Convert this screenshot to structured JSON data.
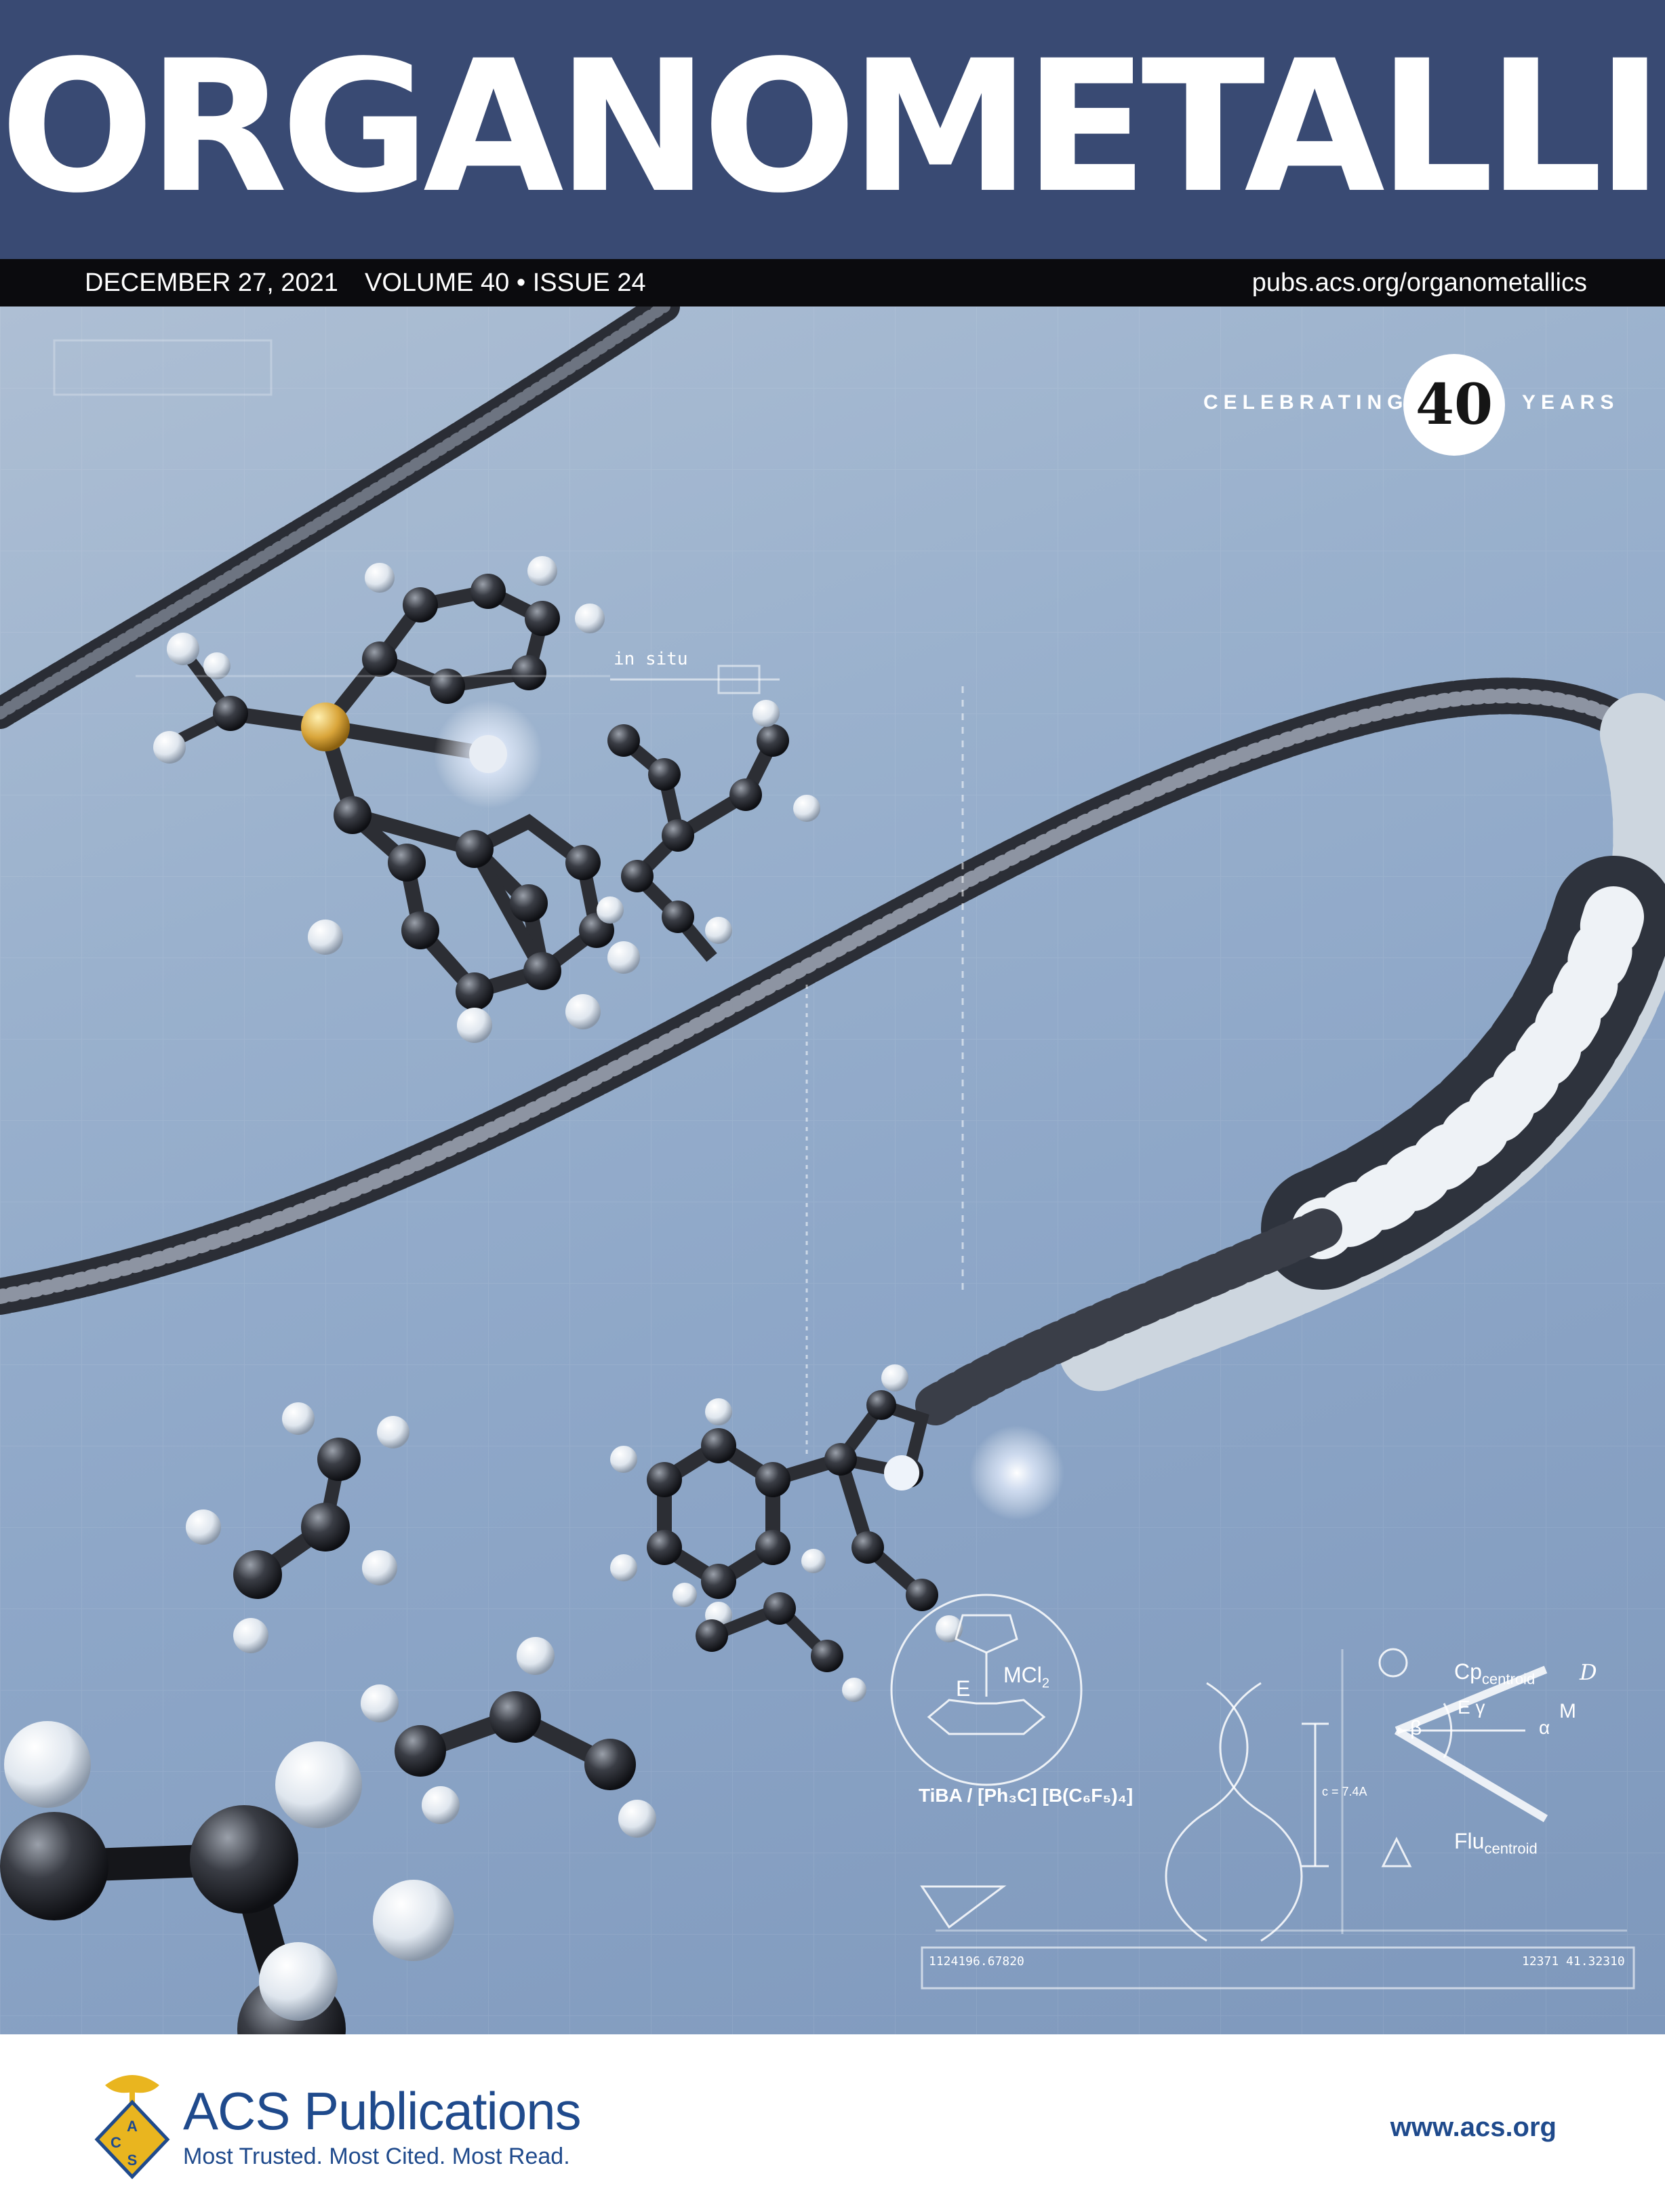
{
  "journal": {
    "title": "ORGANOMETALLICS"
  },
  "issue": {
    "date": "DECEMBER 27, 2021",
    "volume_issue": "VOLUME 40 • ISSUE 24",
    "url": "pubs.acs.org/organometallics"
  },
  "anniversary": {
    "prefix": "CELEBRATING",
    "number": "40",
    "suffix": "YEARS"
  },
  "annotations": {
    "in_situ": "in situ",
    "catalyst_metal_label": "E",
    "catalyst_metal_formula": "MCl",
    "catalyst_metal_subscript": "2",
    "activator": "TiBA / [Ph₃C] [B(C₆F₅)₄]",
    "pitch": "c = 7.4A",
    "cp_centroid": "Cp",
    "cp_centroid_sub": "centroid",
    "flu_centroid": "Flu",
    "flu_centroid_sub": "centroid",
    "angle_beta": "β",
    "angle_gamma": "E γ",
    "angle_alpha": "α",
    "metal_M": "M",
    "distance_D": "D",
    "readout_left": "1124196.67820",
    "readout_right": "12371 41.32310"
  },
  "publisher": {
    "name": "ACS Publications",
    "tagline": "Most Trusted. Most Cited. Most Read.",
    "url": "www.acs.org",
    "logo_letters": [
      "A",
      "C",
      "S"
    ]
  },
  "colors": {
    "masthead": "#394a73",
    "issue_bar": "#0b0b0e",
    "acs_blue": "#1f4a8c",
    "logo_gold": "#e9b51f"
  }
}
